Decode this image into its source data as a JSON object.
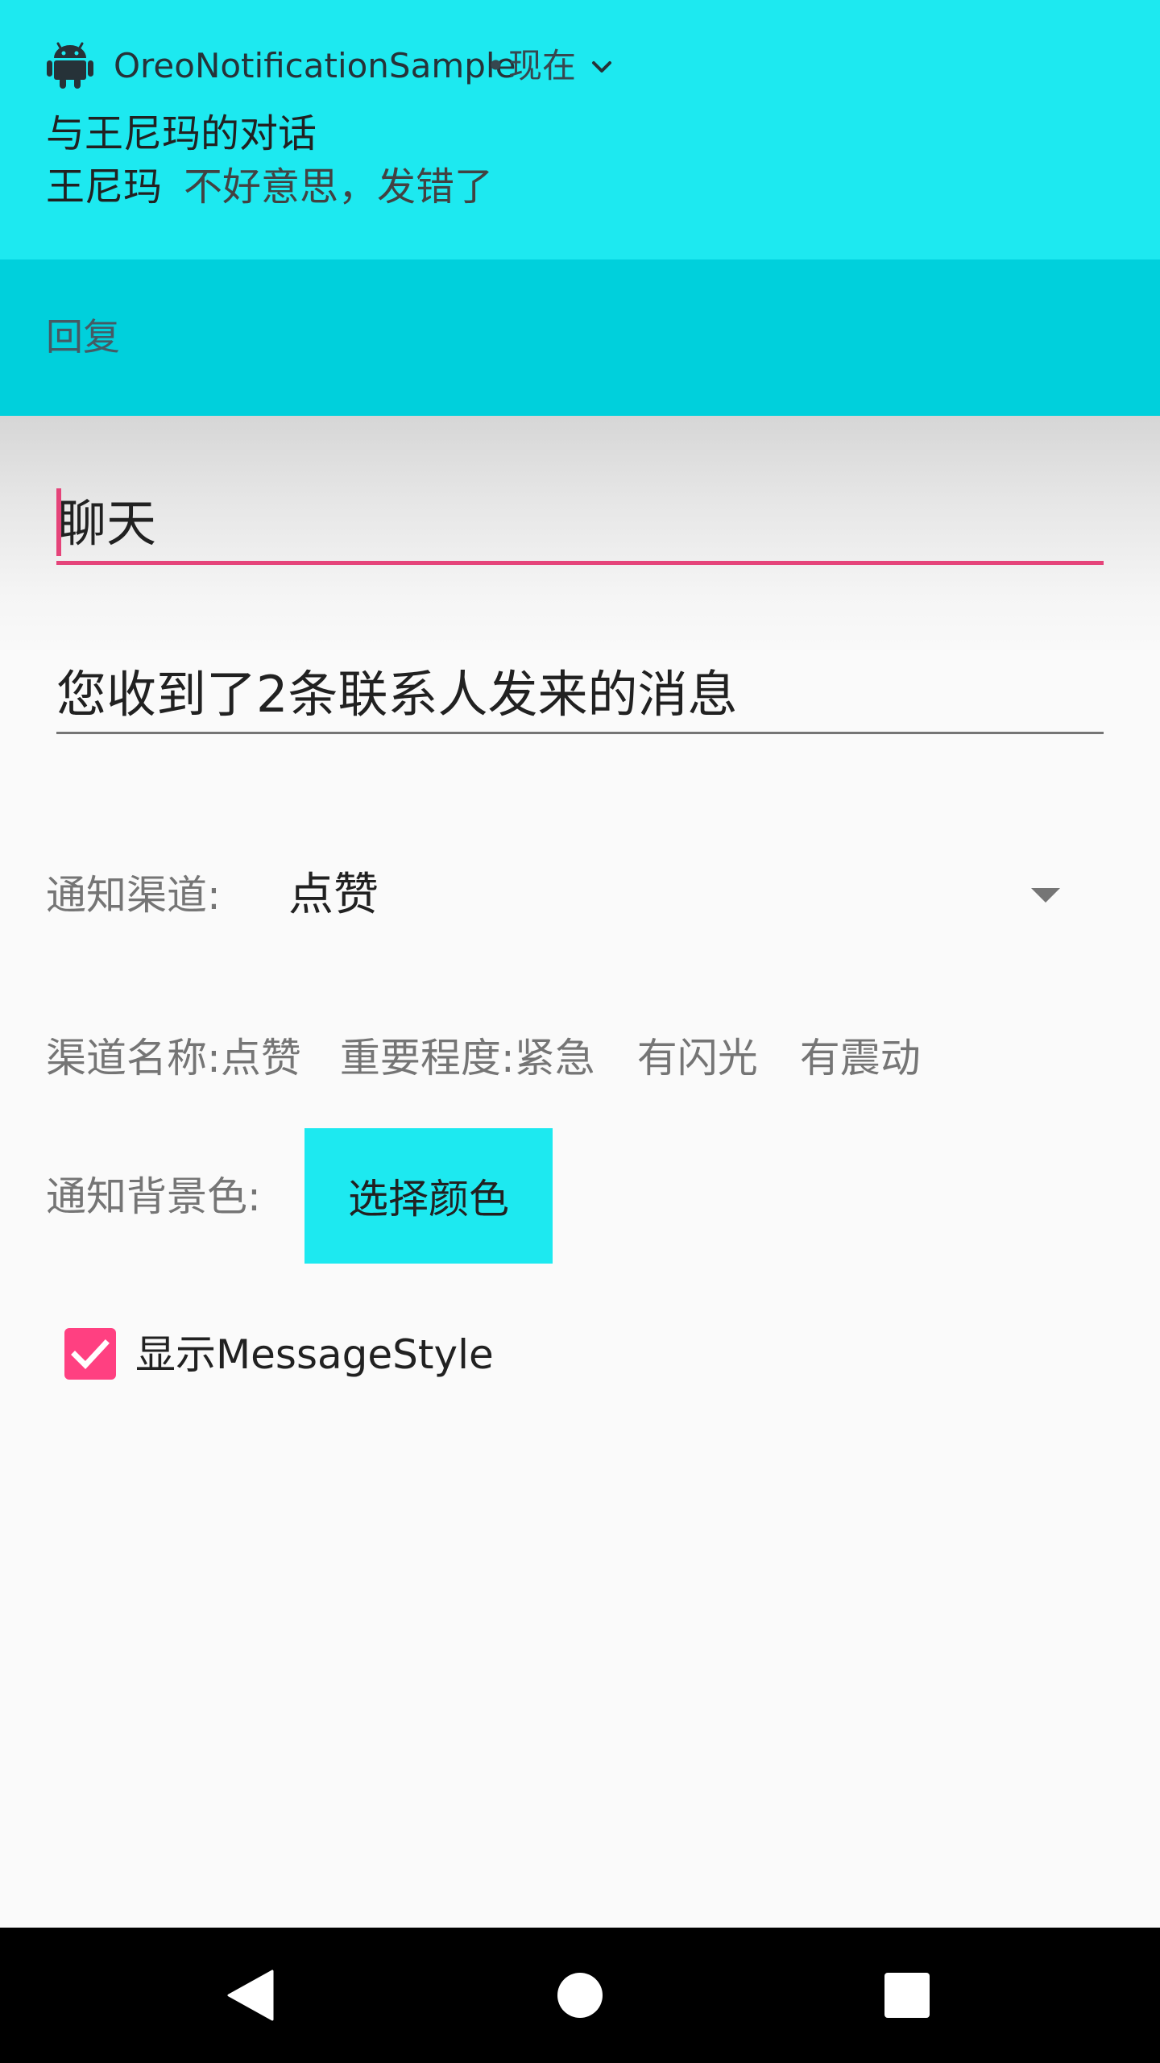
{
  "notification": {
    "app_name": "OreoNotificationSample",
    "separator": "•",
    "time": "现在",
    "conversation_title": "与王尼玛的对话",
    "sender": "王尼玛",
    "message": "不好意思，发错了",
    "action_reply": "回复",
    "background_color": "#1de9f0",
    "action_bar_color": "#00d0dc"
  },
  "form": {
    "title_input_value": "聊天",
    "content_input_value": "您收到了2条联系人发来的消息",
    "channel_label": "通知渠道:",
    "channel_value": "点赞",
    "channel_info": {
      "name": "渠道名称:点赞",
      "importance": "重要程度:紧急",
      "light": "有闪光",
      "vibrate": "有震动"
    },
    "bg_color_label": "通知背景色:",
    "bg_color_button": "选择颜色",
    "message_style_checkbox": {
      "label": "显示MessageStyle",
      "checked": true
    },
    "accent_color": "#e5447a"
  },
  "navbar": {
    "icons": [
      "back-icon",
      "home-icon",
      "recents-icon"
    ]
  }
}
